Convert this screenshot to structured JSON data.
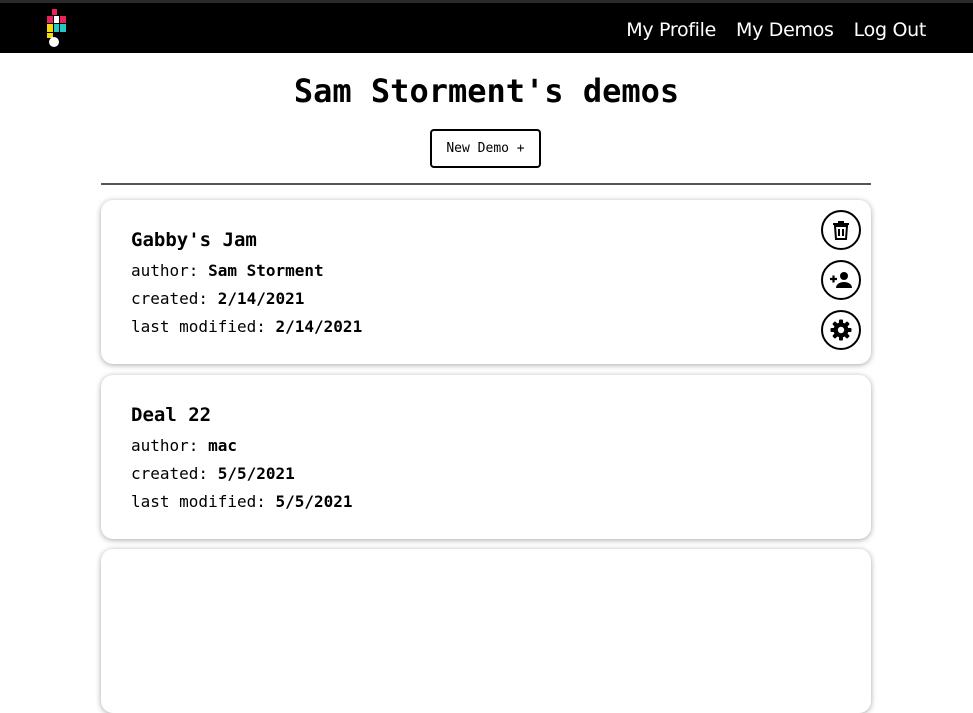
{
  "nav": {
    "links": [
      {
        "label": "My Profile"
      },
      {
        "label": "My Demos"
      },
      {
        "label": "Log Out"
      }
    ]
  },
  "page": {
    "title": "Sam Storment's demos",
    "new_demo_label": "New Demo +"
  },
  "labels": {
    "author": "author:",
    "created": "created:",
    "modified": "last modified:"
  },
  "demos": [
    {
      "title": "Gabby's Jam",
      "author": "Sam Storment",
      "created": "2/14/2021",
      "modified": "2/14/2021",
      "actions": [
        "trash-icon",
        "add-person-icon",
        "gear-icon"
      ]
    },
    {
      "title": "Deal 22",
      "author": "mac",
      "created": "5/5/2021",
      "modified": "5/5/2021"
    }
  ],
  "colors": {
    "navbar": "#000000",
    "logo_red": "#e8245a",
    "logo_yellow": "#f5d90a",
    "logo_teal": "#27c7c4"
  }
}
